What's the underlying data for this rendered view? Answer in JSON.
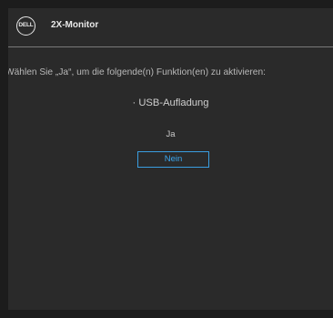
{
  "header": {
    "logo_text": "DELL",
    "title": "2X-Monitor"
  },
  "dialog": {
    "prompt": "Wählen Sie „Ja“, um die folgende(n) Funktion(en) zu aktivieren:",
    "feature": "· USB-Aufladung",
    "yes_label": "Ja",
    "no_label": "Nein"
  },
  "colors": {
    "background": "#2a2a2a",
    "highlight": "#3a9ee0"
  }
}
